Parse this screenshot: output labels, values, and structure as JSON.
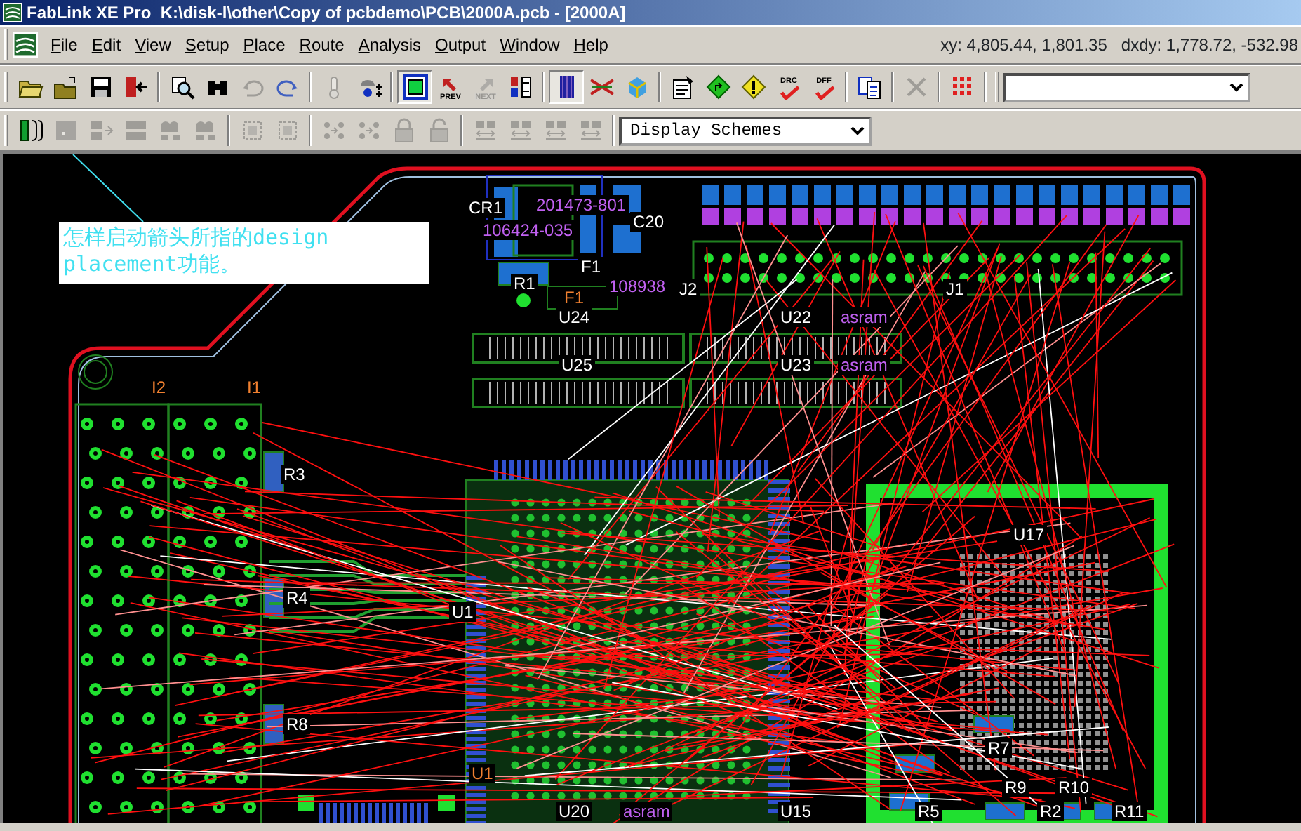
{
  "window": {
    "title": "FabLink XE Pro  K:\\disk-l\\other\\Copy of pcbdemo\\PCB\\2000A.pcb - [2000A]"
  },
  "menu": [
    "File",
    "Edit",
    "View",
    "Setup",
    "Place",
    "Route",
    "Analysis",
    "Output",
    "Window",
    "Help"
  ],
  "coordinates": "xy: 4,805.44, 1,801.35   dxdy: 1,778.72, -532.98",
  "toolbar_main": [
    {
      "kind": "button",
      "disabled": false
    },
    {
      "kind": "button",
      "disabled": false
    },
    {
      "kind": "button",
      "disabled": false
    },
    {
      "kind": "button",
      "disabled": false
    },
    {
      "kind": "button",
      "disabled": false
    },
    {
      "kind": "button",
      "disabled": false
    },
    {
      "kind": "button",
      "disabled": true
    },
    {
      "kind": "button",
      "disabled": false
    },
    {
      "kind": "button",
      "disabled": true
    },
    {
      "kind": "button",
      "disabled": false
    },
    {
      "kind": "toggle",
      "disabled": false,
      "on": true
    },
    {
      "kind": "button",
      "disabled": false,
      "label": "PREV"
    },
    {
      "kind": "button",
      "disabled": true,
      "label": "NEXT"
    },
    {
      "kind": "button",
      "disabled": false
    },
    {
      "kind": "toggle",
      "disabled": false,
      "on": true
    },
    {
      "kind": "button",
      "disabled": false
    },
    {
      "kind": "button",
      "disabled": false
    },
    {
      "kind": "button",
      "disabled": false
    },
    {
      "kind": "button",
      "disabled": false
    },
    {
      "kind": "button",
      "disabled": false
    },
    {
      "kind": "button",
      "disabled": false,
      "label": "DRC"
    },
    {
      "kind": "button",
      "disabled": false,
      "label": "DFF"
    },
    {
      "kind": "button",
      "disabled": false
    },
    {
      "kind": "button",
      "disabled": true
    },
    {
      "kind": "button",
      "disabled": false
    }
  ],
  "toolbar_placement": [
    {
      "disabled": false
    },
    {
      "disabled": true
    },
    {
      "disabled": true
    },
    {
      "disabled": true
    },
    {
      "disabled": true
    },
    {
      "disabled": true
    },
    {
      "disabled": true
    },
    {
      "disabled": true
    },
    {
      "disabled": true
    },
    {
      "disabled": true
    },
    {
      "disabled": true
    },
    {
      "disabled": true
    },
    {
      "disabled": true
    },
    {
      "disabled": true
    },
    {
      "disabled": true
    },
    {
      "disabled": true
    }
  ],
  "display_schemes": {
    "value": "Display Schemes"
  },
  "annotation": {
    "text": "怎样启动箭头所指的design placement功能。"
  },
  "board_labels": [
    {
      "text": "CR1",
      "kind": "refdes"
    },
    {
      "text": "201473-801",
      "kind": "partnumber"
    },
    {
      "text": "106424-035",
      "kind": "partnumber"
    },
    {
      "text": "C20",
      "kind": "refdes"
    },
    {
      "text": "R1",
      "kind": "refdes"
    },
    {
      "text": "F1",
      "kind": "refdes"
    },
    {
      "text": "F1",
      "kind": "assembly"
    },
    {
      "text": "108938",
      "kind": "partnumber"
    },
    {
      "text": "J2",
      "kind": "refdes"
    },
    {
      "text": "J1",
      "kind": "refdes"
    },
    {
      "text": "U24",
      "kind": "refdes"
    },
    {
      "text": "U22",
      "kind": "refdes"
    },
    {
      "text": "asram",
      "kind": "partnumber"
    },
    {
      "text": "U25",
      "kind": "refdes"
    },
    {
      "text": "U23",
      "kind": "refdes"
    },
    {
      "text": "asram",
      "kind": "partnumber"
    },
    {
      "text": "I2",
      "kind": "assembly"
    },
    {
      "text": "I1",
      "kind": "assembly"
    },
    {
      "text": "R3",
      "kind": "refdes"
    },
    {
      "text": "U17",
      "kind": "refdes"
    },
    {
      "text": "R4",
      "kind": "refdes"
    },
    {
      "text": "U1",
      "kind": "refdes"
    },
    {
      "text": "R8",
      "kind": "refdes"
    },
    {
      "text": "R7",
      "kind": "refdes"
    },
    {
      "text": "U1",
      "kind": "assembly"
    },
    {
      "text": "R9",
      "kind": "refdes"
    },
    {
      "text": "R10",
      "kind": "refdes"
    },
    {
      "text": "U20",
      "kind": "refdes"
    },
    {
      "text": "asram",
      "kind": "partnumber"
    },
    {
      "text": "U15",
      "kind": "refdes"
    },
    {
      "text": "R5",
      "kind": "refdes"
    },
    {
      "text": "R2",
      "kind": "refdes"
    },
    {
      "text": "R11",
      "kind": "refdes"
    }
  ]
}
